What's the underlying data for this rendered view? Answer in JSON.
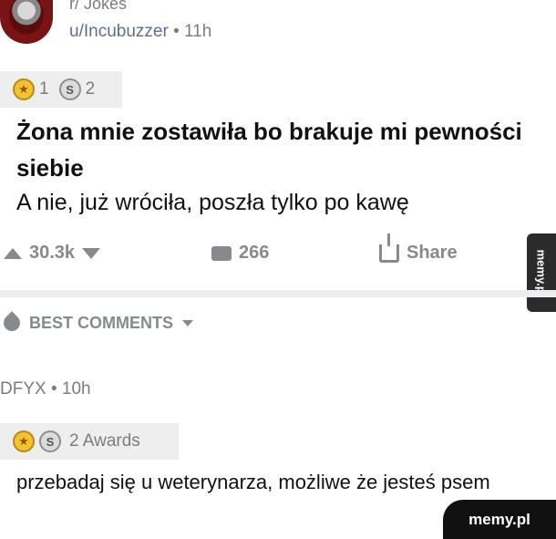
{
  "post": {
    "subreddit": "r/ Jokes",
    "username": "u/Incubuzzer",
    "separator": "•",
    "age": "11h",
    "awards": {
      "gold_count": "1",
      "silver_count": "2"
    },
    "title": "Żona mnie zostawiła bo brakuje mi pewności siebie",
    "body": "A nie, już wróciła, poszła tylko po kawę"
  },
  "actions": {
    "upvotes": "30.3k",
    "comments": "266",
    "share_label": "Share"
  },
  "comments_header": {
    "sort_label": "BEST COMMENTS"
  },
  "comment": {
    "username": "DFYX",
    "separator": "•",
    "age": "10h",
    "awards_label": "2 Awards",
    "body": "przebadaj się u weterynarza, możliwe że jesteś psem"
  },
  "watermark": {
    "side_text": "memy.pl",
    "corner_text": "memy.pl"
  },
  "colors": {
    "accent_user": "#5f6f8c",
    "muted": "#878a8c",
    "gold": "#f2c230"
  },
  "icons": [
    "avatar-image",
    "gold-award-icon",
    "silver-award-icon",
    "upvote-icon",
    "downvote-icon",
    "comment-icon",
    "share-icon",
    "rocket-icon",
    "chevron-down-icon"
  ]
}
